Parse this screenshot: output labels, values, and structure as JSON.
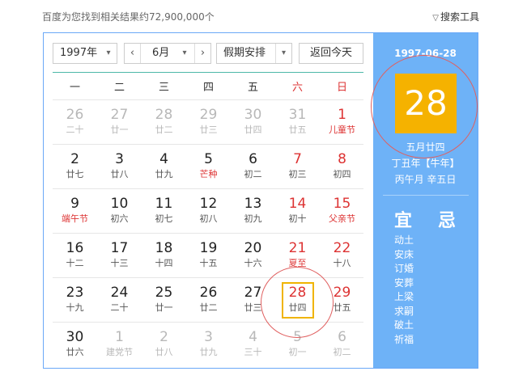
{
  "header": {
    "result_count": "百度为您找到相关结果约72,900,000个",
    "search_tools": "搜索工具",
    "search_tools_icon": "filter-funnel-icon"
  },
  "controls": {
    "year": "1997年",
    "month": "6月",
    "holiday": "假期安排",
    "today_button": "返回今天",
    "prev_symbol": "‹",
    "next_symbol": "›",
    "dropdown_symbol": "▾"
  },
  "weekdays": [
    "一",
    "二",
    "三",
    "四",
    "五",
    "六",
    "日"
  ],
  "weeks": [
    [
      {
        "day": "26",
        "lunar": "二十",
        "other": true
      },
      {
        "day": "27",
        "lunar": "廿一",
        "other": true
      },
      {
        "day": "28",
        "lunar": "廿二",
        "other": true
      },
      {
        "day": "29",
        "lunar": "廿三",
        "other": true
      },
      {
        "day": "30",
        "lunar": "廿四",
        "other": true
      },
      {
        "day": "31",
        "lunar": "廿五",
        "other": true
      },
      {
        "day": "1",
        "lunar": "儿童节",
        "festival": true
      }
    ],
    [
      {
        "day": "2",
        "lunar": "廿七"
      },
      {
        "day": "3",
        "lunar": "廿八"
      },
      {
        "day": "4",
        "lunar": "廿九"
      },
      {
        "day": "5",
        "lunar": "芒种",
        "festival": true
      },
      {
        "day": "6",
        "lunar": "初二"
      },
      {
        "day": "7",
        "lunar": "初三"
      },
      {
        "day": "8",
        "lunar": "初四"
      }
    ],
    [
      {
        "day": "9",
        "lunar": "端午节",
        "festival": true
      },
      {
        "day": "10",
        "lunar": "初六"
      },
      {
        "day": "11",
        "lunar": "初七"
      },
      {
        "day": "12",
        "lunar": "初八"
      },
      {
        "day": "13",
        "lunar": "初九"
      },
      {
        "day": "14",
        "lunar": "初十"
      },
      {
        "day": "15",
        "lunar": "父亲节",
        "festival": true
      }
    ],
    [
      {
        "day": "16",
        "lunar": "十二"
      },
      {
        "day": "17",
        "lunar": "十三"
      },
      {
        "day": "18",
        "lunar": "十四"
      },
      {
        "day": "19",
        "lunar": "十五"
      },
      {
        "day": "20",
        "lunar": "十六"
      },
      {
        "day": "21",
        "lunar": "夏至",
        "festival": true
      },
      {
        "day": "22",
        "lunar": "十八"
      }
    ],
    [
      {
        "day": "23",
        "lunar": "十九"
      },
      {
        "day": "24",
        "lunar": "二十"
      },
      {
        "day": "25",
        "lunar": "廿一"
      },
      {
        "day": "26",
        "lunar": "廿二"
      },
      {
        "day": "27",
        "lunar": "廿三"
      },
      {
        "day": "28",
        "lunar": "廿四",
        "selected": true
      },
      {
        "day": "29",
        "lunar": "廿五"
      }
    ],
    [
      {
        "day": "30",
        "lunar": "廿六"
      },
      {
        "day": "1",
        "lunar": "建党节",
        "other": true
      },
      {
        "day": "2",
        "lunar": "廿八",
        "other": true
      },
      {
        "day": "3",
        "lunar": "廿九",
        "other": true
      },
      {
        "day": "4",
        "lunar": "三十",
        "other": true
      },
      {
        "day": "5",
        "lunar": "初一",
        "other": true
      },
      {
        "day": "6",
        "lunar": "初二",
        "other": true
      }
    ]
  ],
  "detail": {
    "date": "1997-06-28",
    "day": "28",
    "lunar_date": "五月廿四",
    "year_ganzhi": "丁丑年【牛年】",
    "month_day_ganzhi": "丙午月 辛五日",
    "yi_label": "宜",
    "ji_label": "忌",
    "yi_items": [
      "动土",
      "安床",
      "订婚",
      "安葬",
      "上梁",
      "求嗣",
      "破土",
      "祈福"
    ]
  },
  "colors": {
    "accent_blue": "#6eb2f7",
    "selected_yellow": "#f5b200",
    "weekend_red": "#dd3333"
  }
}
